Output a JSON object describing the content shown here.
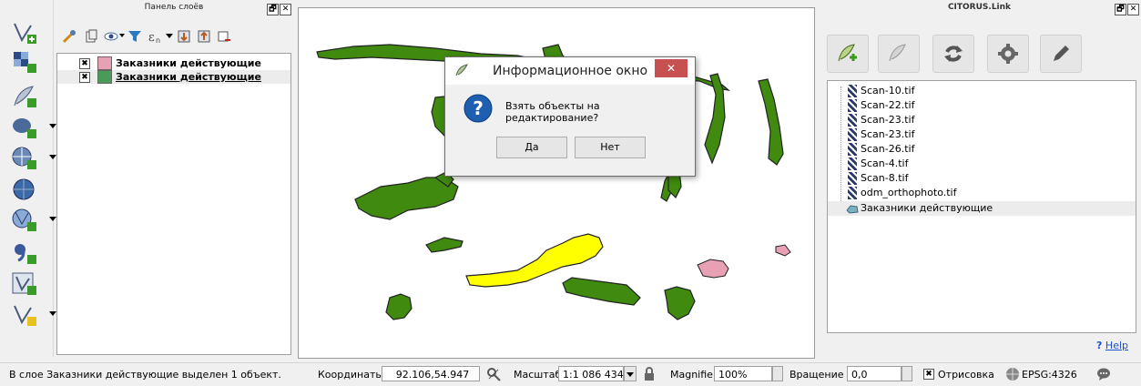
{
  "layers_panel": {
    "title": "Панель слоёв",
    "layers": [
      {
        "name": "Заказники действующие",
        "checked": "✖",
        "color": "#e8a0b4"
      },
      {
        "name": "Заказники действующие",
        "checked": "✖",
        "color": "#4a9a5a"
      }
    ]
  },
  "dock_buttons": {
    "float": "🗗",
    "close": "✕"
  },
  "dialog": {
    "title": "Информационное окно",
    "close": "✕",
    "message": "Взять объекты на редактирование?",
    "yes": "Да",
    "no": "Нет"
  },
  "citorus": {
    "title": "CITORUS.Link",
    "rasters": [
      "Scan-10.tif",
      "Scan-22.tif",
      "Scan-23.tif",
      "Scan-23.tif",
      "Scan-26.tif",
      "Scan-4.tif",
      "Scan-8.tif",
      "odm_orthophoto.tif"
    ],
    "vector_layer": "Заказники действующие",
    "help_mark": "?",
    "help": "Help"
  },
  "status": {
    "message": "В слое Заказники действующие выделен 1 объект.",
    "coords_label": "Координаты",
    "coords_value": "92.106,54.947",
    "scale_label": "Масштаб",
    "scale_value": "1:1 086 434",
    "magnifier_label": "Magnifier",
    "magnifier_value": "100%",
    "rotation_label": "Вращение",
    "rotation_value": "0,0",
    "render_check": "✖",
    "render_label": "Отрисовка",
    "epsg": "EPSG:4326"
  },
  "colors": {
    "polygon_green": "#3f8a0f",
    "selected_yellow": "#ffff00",
    "pink": "#e8a0b4",
    "accent_red": "#c75050"
  }
}
